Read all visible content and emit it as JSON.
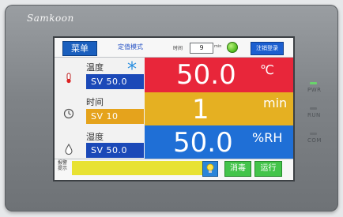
{
  "brand": "Samkoon",
  "toolbar": {
    "menu_label": "菜单",
    "mode_label": "定值模式",
    "time_label": "时间",
    "time_value": "9",
    "time_unit": "min",
    "logout_label": "注销登录"
  },
  "rows": [
    {
      "label": "温度",
      "sv_text": "SV 50.0",
      "value": "50.0",
      "unit": "℃",
      "icon": "thermometer-icon"
    },
    {
      "label": "时间",
      "sv_text": "SV  10",
      "value": "1",
      "unit": "min",
      "icon": "clock-icon"
    },
    {
      "label": "湿度",
      "sv_text": "SV  50.0",
      "value": "50.0",
      "unit": "%RH",
      "icon": "droplet-icon"
    }
  ],
  "bottom": {
    "alarm_label": "报警提示",
    "mute_label": "消毒",
    "run_label": "运行"
  },
  "device_leds": [
    "PWR",
    "RUN",
    "COM"
  ],
  "colors": {
    "temp_panel": "#e8263a",
    "time_panel": "#e5b022",
    "humid_panel": "#1f6fd6",
    "sv_blue": "#1b49b8",
    "sv_orange": "#e5a31c"
  }
}
